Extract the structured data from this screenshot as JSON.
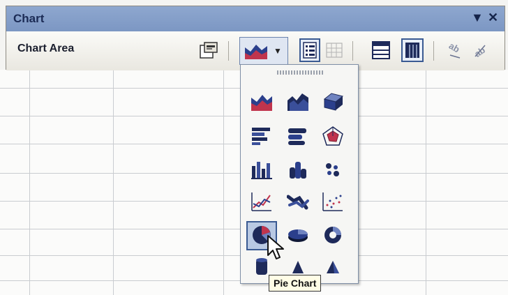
{
  "toolbar": {
    "title": "Chart",
    "chart_objects": {
      "selected": "Chart Area"
    },
    "buttons": [
      {
        "name": "format-chart-area",
        "icon": "format-properties-icon"
      },
      {
        "name": "chart-type",
        "icon": "area-chart-icon"
      },
      {
        "name": "legend",
        "icon": "legend-icon"
      },
      {
        "name": "data-table",
        "icon": "data-table-icon"
      },
      {
        "name": "by-row",
        "icon": "by-row-icon"
      },
      {
        "name": "by-column",
        "icon": "by-column-icon"
      },
      {
        "name": "angle-text-downward",
        "icon": "angle-text-down-icon"
      },
      {
        "name": "angle-text-upward",
        "icon": "angle-text-up-icon"
      }
    ]
  },
  "chart_type_palette": {
    "items": [
      {
        "name": "area-chart",
        "icon": "area-chart-icon"
      },
      {
        "name": "3d-area-chart",
        "icon": "3d-area-chart-icon"
      },
      {
        "name": "3d-surface-chart",
        "icon": "3d-surface-chart-icon"
      },
      {
        "name": "bar-chart",
        "icon": "bar-chart-icon"
      },
      {
        "name": "3d-bar-chart",
        "icon": "3d-bar-chart-icon"
      },
      {
        "name": "radar-chart",
        "icon": "radar-chart-icon"
      },
      {
        "name": "column-chart",
        "icon": "column-chart-icon"
      },
      {
        "name": "3d-column-chart",
        "icon": "3d-column-chart-icon"
      },
      {
        "name": "bubble-chart",
        "icon": "bubble-chart-icon"
      },
      {
        "name": "line-chart",
        "icon": "line-chart-icon"
      },
      {
        "name": "3d-line-chart",
        "icon": "3d-line-chart-icon"
      },
      {
        "name": "xy-scatter-chart",
        "icon": "scatter-chart-icon"
      },
      {
        "name": "pie-chart",
        "icon": "pie-chart-icon",
        "selected": true
      },
      {
        "name": "3d-pie-chart",
        "icon": "3d-pie-chart-icon"
      },
      {
        "name": "doughnut-chart",
        "icon": "doughnut-chart-icon"
      },
      {
        "name": "cylinder-chart",
        "icon": "cylinder-chart-icon"
      },
      {
        "name": "cone-chart",
        "icon": "cone-chart-icon"
      },
      {
        "name": "pyramid-chart",
        "icon": "pyramid-chart-icon"
      }
    ],
    "tooltip": "Pie Chart"
  },
  "colors": {
    "titlebar": "#8ea7cf",
    "icon_blue": "#2b3f8c",
    "icon_red": "#c0344d",
    "selection": "#b9c9e3"
  }
}
